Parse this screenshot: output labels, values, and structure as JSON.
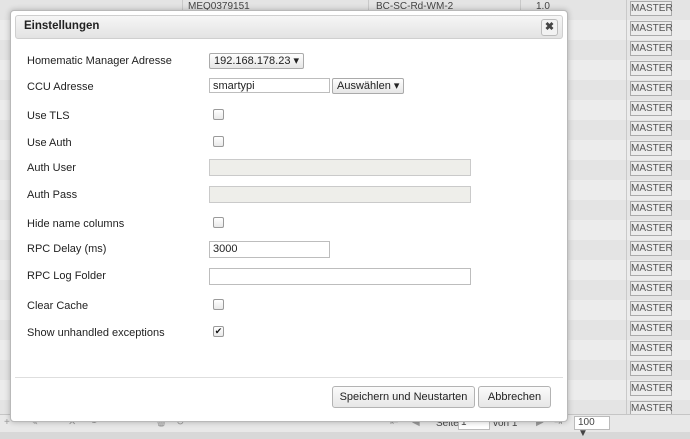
{
  "background": {
    "row1": {
      "serial": "MEQ0379151",
      "type": "BC-SC-Rd-WM-2",
      "version": "1.0"
    },
    "master_label": "MASTER",
    "pager": {
      "page_label": "Seite",
      "page_value": "1",
      "of_label": "von 1",
      "rows_per_page": "100 ▼"
    }
  },
  "dialog": {
    "title": "Einstellungen",
    "close_glyph": "✖",
    "fields": {
      "manager_address": {
        "label": "Homematic Manager Adresse",
        "value": "192.168.178.23 ▾"
      },
      "ccu_address": {
        "label": "CCU Adresse",
        "value": "smartypi",
        "select_label": "Auswählen ▾"
      },
      "use_tls": {
        "label": "Use TLS",
        "checked": false
      },
      "use_auth": {
        "label": "Use Auth",
        "checked": false
      },
      "auth_user": {
        "label": "Auth User",
        "value": ""
      },
      "auth_pass": {
        "label": "Auth Pass",
        "value": ""
      },
      "hide_name_columns": {
        "label": "Hide name columns",
        "checked": false
      },
      "rpc_delay": {
        "label": "RPC Delay (ms)",
        "value": "3000"
      },
      "rpc_log_folder": {
        "label": "RPC Log Folder",
        "value": ""
      },
      "clear_cache": {
        "label": "Clear Cache",
        "checked": false
      },
      "show_unhandled": {
        "label": "Show unhandled exceptions",
        "checked": true,
        "check_glyph": "✔"
      }
    },
    "buttons": {
      "save_label": "Speichern und Neustarten",
      "cancel_label": "Abbrechen"
    }
  }
}
